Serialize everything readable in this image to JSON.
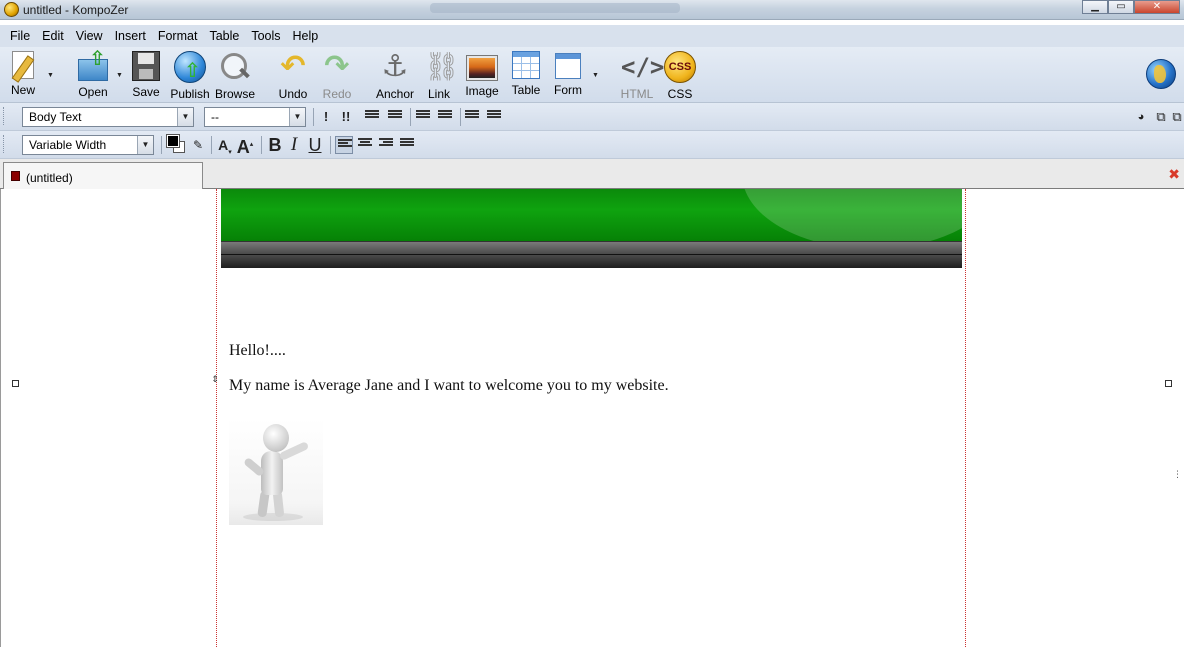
{
  "window": {
    "title": "untitled - KompoZer",
    "controls": {
      "minimize": "▁",
      "maximize": "▭",
      "close": "✕"
    }
  },
  "menu": [
    "File",
    "Edit",
    "View",
    "Insert",
    "Format",
    "Table",
    "Tools",
    "Help"
  ],
  "toolbar": {
    "new": "New",
    "open": "Open",
    "save": "Save",
    "publish": "Publish",
    "browse": "Browse",
    "undo": "Undo",
    "redo": "Redo",
    "anchor": "Anchor",
    "link": "Link",
    "image": "Image",
    "table": "Table",
    "form": "Form",
    "html": "HTML",
    "css": "CSS",
    "css_badge": "CSS",
    "dropdown_arrow": "▼"
  },
  "format1": {
    "paragraph_format": "Body Text",
    "class_select": "--",
    "select_arrow": "▼"
  },
  "format2": {
    "font_select": "Variable Width",
    "select_arrow": "▼",
    "bold": "B",
    "italic": "I",
    "underline": "U"
  },
  "tabs": [
    {
      "label": "(untitled)",
      "active": true
    }
  ],
  "document": {
    "greeting": "Hello!....",
    "intro": "My name is Average Jane and I want to welcome you to my website."
  },
  "icons": {
    "undo": "↶",
    "redo": "↷",
    "anchor": "⚓",
    "link": "⛓",
    "html": "</>",
    "tab_close": "✖"
  },
  "colors": {
    "banner_green": "#0fa30f",
    "text_color": "#000000",
    "background_color": "#ffffff"
  }
}
